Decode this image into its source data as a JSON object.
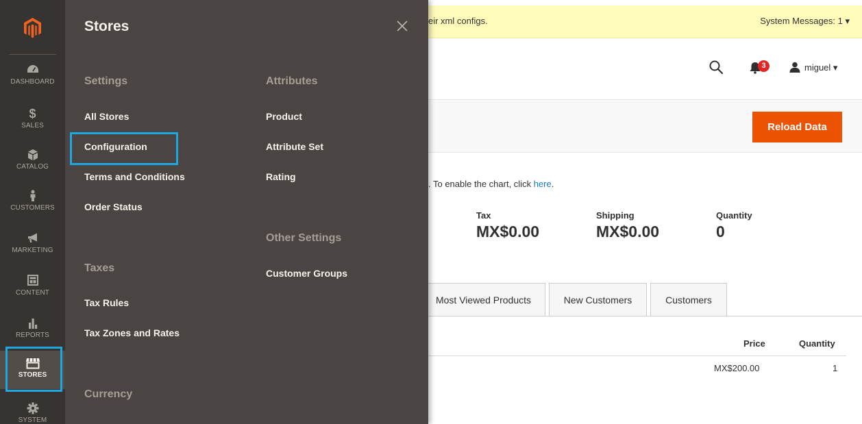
{
  "rail": {
    "items": [
      {
        "label": "DASHBOARD",
        "icon": "dashboard-icon"
      },
      {
        "label": "SALES",
        "icon": "dollar-icon"
      },
      {
        "label": "CATALOG",
        "icon": "box-icon"
      },
      {
        "label": "CUSTOMERS",
        "icon": "person-icon"
      },
      {
        "label": "MARKETING",
        "icon": "megaphone-icon"
      },
      {
        "label": "CONTENT",
        "icon": "layout-icon"
      },
      {
        "label": "REPORTS",
        "icon": "bar-chart-icon"
      },
      {
        "label": "STORES",
        "icon": "storefront-icon"
      },
      {
        "label": "SYSTEM",
        "icon": "gear-icon"
      }
    ]
  },
  "flyout": {
    "title": "Stores",
    "settings": {
      "heading": "Settings",
      "links": [
        "All Stores",
        "Configuration",
        "Terms and Conditions",
        "Order Status"
      ]
    },
    "taxes": {
      "heading": "Taxes",
      "links": [
        "Tax Rules",
        "Tax Zones and Rates"
      ]
    },
    "currency": {
      "heading": "Currency"
    },
    "attributes": {
      "heading": "Attributes",
      "links": [
        "Product",
        "Attribute Set",
        "Rating"
      ]
    },
    "other": {
      "heading": "Other Settings",
      "links": [
        "Customer Groups"
      ]
    }
  },
  "message": {
    "text": "eir xml configs.",
    "system_messages": "System Messages: 1 ▾"
  },
  "header": {
    "notifications_count": "3",
    "user": "miguel ▾"
  },
  "actions": {
    "reload": "Reload Data"
  },
  "dashboard": {
    "chart_message": ". To enable the chart, click ",
    "chart_link": "here",
    "chart_message_end": ".",
    "stats": [
      {
        "label": "Tax",
        "value": "MX$0.00"
      },
      {
        "label": "Shipping",
        "value": "MX$0.00"
      },
      {
        "label": "Quantity",
        "value": "0"
      }
    ],
    "tabs": [
      "Most Viewed Products",
      "New Customers",
      "Customers"
    ],
    "table": {
      "headers": [
        "Price",
        "Quantity"
      ],
      "rows": [
        [
          "MX$200.00",
          "1"
        ]
      ]
    }
  },
  "colors": {
    "rail": "#373330",
    "flyout": "#4a4542",
    "highlight": "#1ea7e1",
    "primary_button": "#eb5202",
    "message_bar": "#fffbbb"
  }
}
